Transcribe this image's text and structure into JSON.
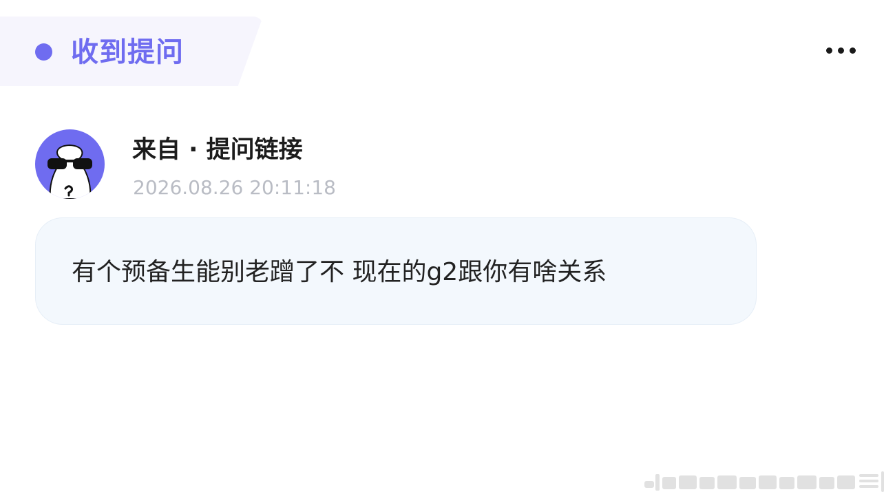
{
  "header": {
    "title": "收到提问",
    "accent_color": "#6f6cf0",
    "more_icon": "more-horizontal-icon"
  },
  "question": {
    "sender": "来自 · 提问链接",
    "timestamp": "2026.08.26 20:11:18",
    "avatar_icon": "anonymous-sunglasses-avatar-icon",
    "text": "有个预备生能别老蹭了不 现在的g2跟你有啥关系"
  }
}
